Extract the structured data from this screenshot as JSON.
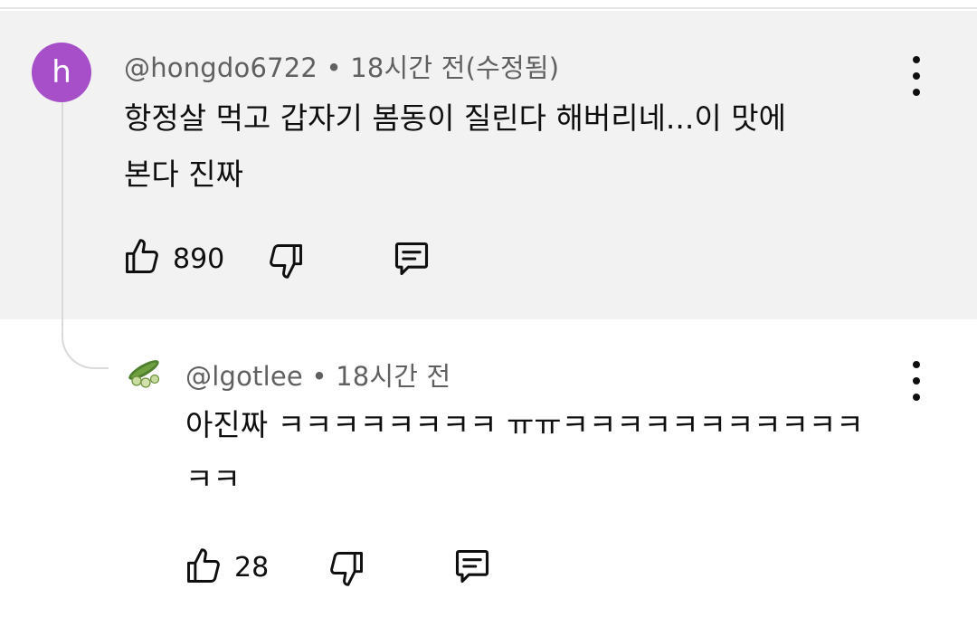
{
  "comments": [
    {
      "avatar_letter": "h",
      "avatar_color": "#a64fc8",
      "author": "@hongdo6722",
      "separator": "•",
      "time": "18시간 전(수정됨)",
      "text_line1": "항정살 먹고 갑자기 봄동이 질린다 해버리네...이 맛에",
      "text_line2": "본다 진짜",
      "likes": "890",
      "highlighted": true
    },
    {
      "author": "@lgotlee",
      "separator": "•",
      "time": "18시간 전",
      "text_line1": "아진짜 ㅋㅋㅋㅋㅋㅋㅋㅋ ㅠㅠㅋㅋㅋㅋㅋㅋㅋㅋㅋㅋㅋ",
      "text_line2": "ㅋㅋ",
      "likes": "28",
      "avatar_icon": "cucumber-avatar-icon"
    }
  ],
  "icons": {
    "like": "thumbs-up-icon",
    "dislike": "thumbs-down-icon",
    "reply": "reply-comment-icon",
    "menu": "more-vertical-icon"
  }
}
